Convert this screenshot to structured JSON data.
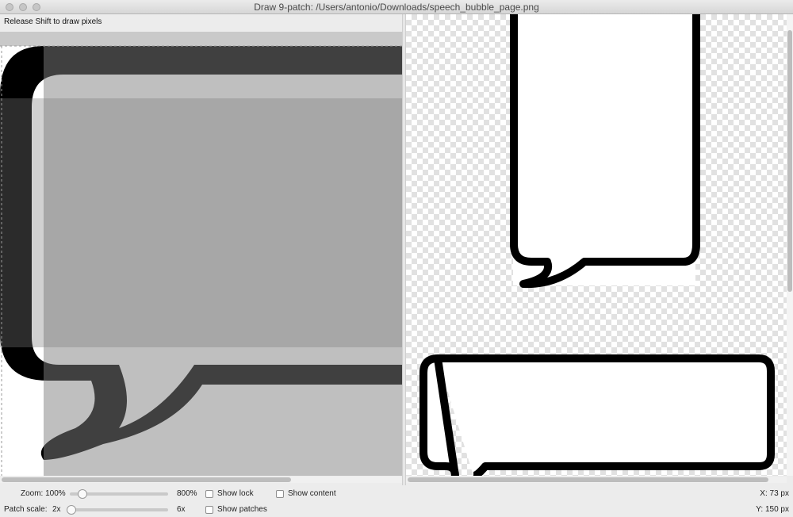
{
  "window": {
    "title": "Draw 9-patch: /Users/antonio/Downloads/speech_bubble_page.png"
  },
  "status_text": "Release Shift to draw pixels",
  "controls": {
    "zoom_label": "Zoom: 100%",
    "zoom_max": "800%",
    "patch_scale_label": "Patch scale:",
    "patch_scale_min": "2x",
    "patch_scale_max": "6x",
    "show_lock": "Show lock",
    "show_content": "Show content",
    "show_patches": "Show patches",
    "x_readout": "X:   73 px",
    "y_readout": "Y: 150 px"
  }
}
